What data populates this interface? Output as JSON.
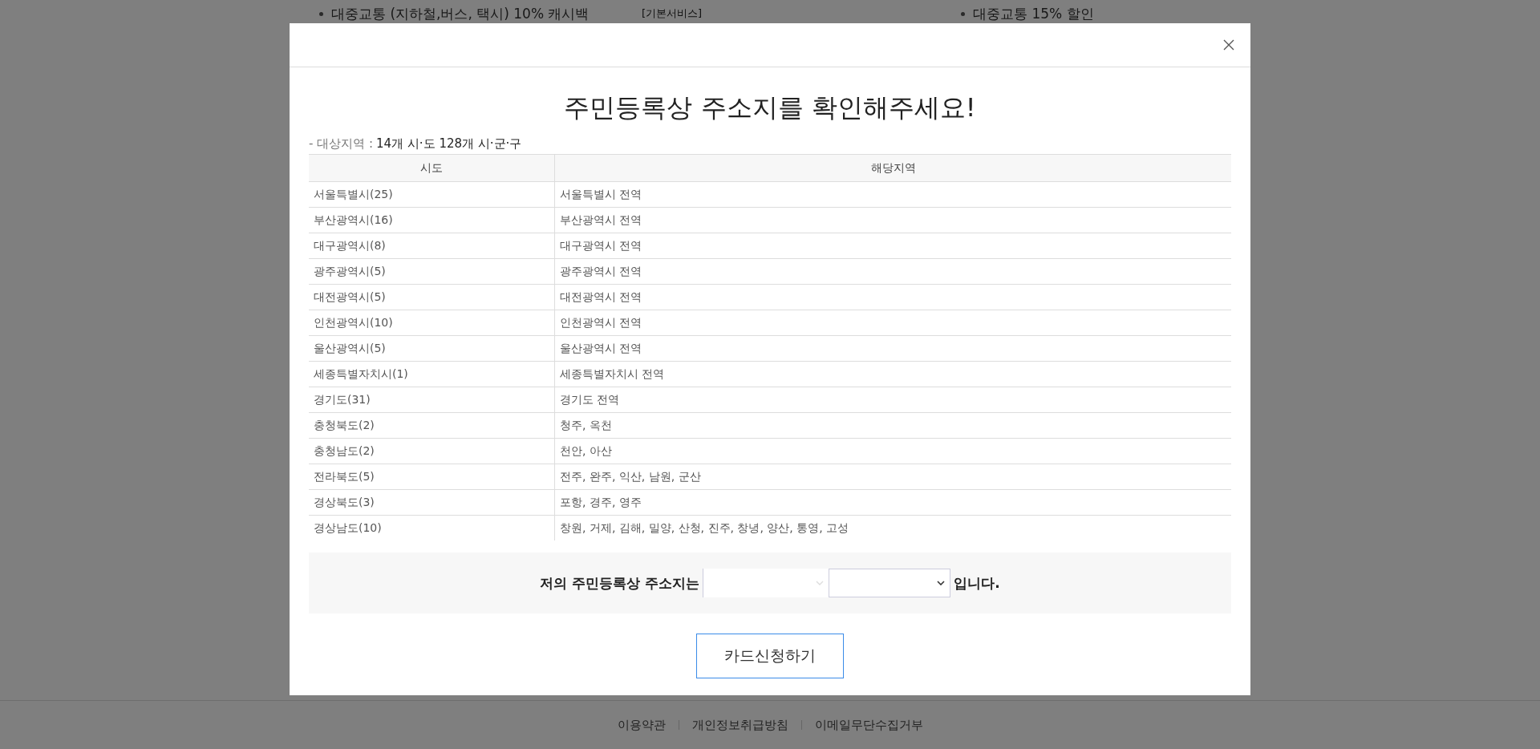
{
  "background_page": {
    "benefits": [
      {
        "text": "대중교통 (지하철,버스, 택시) 10% 캐시백",
        "kind": "bullet"
      },
      {
        "text": "[기본서비스]",
        "kind": "tag"
      },
      {
        "text": "대중교통 15% 할인",
        "kind": "bullet"
      }
    ],
    "footer_links": [
      "이용약관",
      "개인정보취급방침",
      "이메일무단수집거부"
    ]
  },
  "modal": {
    "title": "주민등록상 주소지를 확인해주세요!",
    "target_label": "- 대상지역 :",
    "target_value": "14개 시·도 128개 시·군·구",
    "table": {
      "columns": [
        "시도",
        "해당지역"
      ],
      "rows": [
        [
          "서울특별시(25)",
          "서울특별시 전역"
        ],
        [
          "부산광역시(16)",
          "부산광역시 전역"
        ],
        [
          "대구광역시(8)",
          "대구광역시 전역"
        ],
        [
          "광주광역시(5)",
          "광주광역시 전역"
        ],
        [
          "대전광역시(5)",
          "대전광역시 전역"
        ],
        [
          "인천광역시(10)",
          "인천광역시 전역"
        ],
        [
          "울산광역시(5)",
          "울산광역시 전역"
        ],
        [
          "세종특별자치시(1)",
          "세종특별자치시 전역"
        ],
        [
          "경기도(31)",
          "경기도 전역"
        ],
        [
          "충청북도(2)",
          "청주, 옥천"
        ],
        [
          "충청남도(2)",
          "천안, 아산"
        ],
        [
          "전라북도(5)",
          "전주, 완주, 익산, 남원, 군산"
        ],
        [
          "경상북도(3)",
          "포항, 경주, 영주"
        ],
        [
          "경상남도(10)",
          "창원, 거제, 김해, 밀양, 산청, 진주, 창녕, 양산, 통영, 고성"
        ]
      ]
    },
    "address": {
      "prefix": "저의 주민등록상 주소지는",
      "suffix": "입니다."
    },
    "submit_button": "카드신청하기"
  }
}
